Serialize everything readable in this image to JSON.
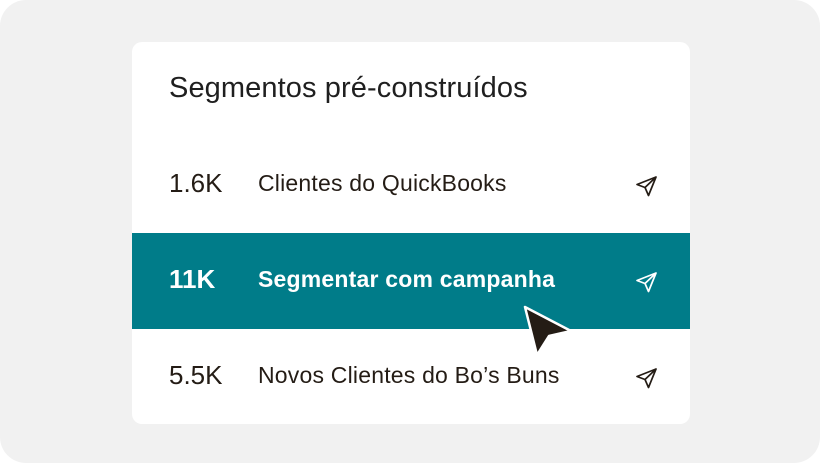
{
  "card": {
    "title": "Segmentos pré-construídos"
  },
  "segments": [
    {
      "count": "1.6K",
      "label": "Clientes do QuickBooks",
      "icon": "send-icon",
      "selected": false
    },
    {
      "count": "11K",
      "label": "Segmentar com campanha",
      "icon": "send-icon",
      "selected": true
    },
    {
      "count": "5.5K",
      "label": "Novos Clientes do Bo’s Buns",
      "icon": "send-icon",
      "selected": false
    }
  ],
  "colors": {
    "highlight": "#007c89",
    "text": "#241c15",
    "background": "#f1f1f1",
    "card": "#ffffff"
  },
  "icons": {
    "cursor": "pointer-cursor-icon"
  }
}
